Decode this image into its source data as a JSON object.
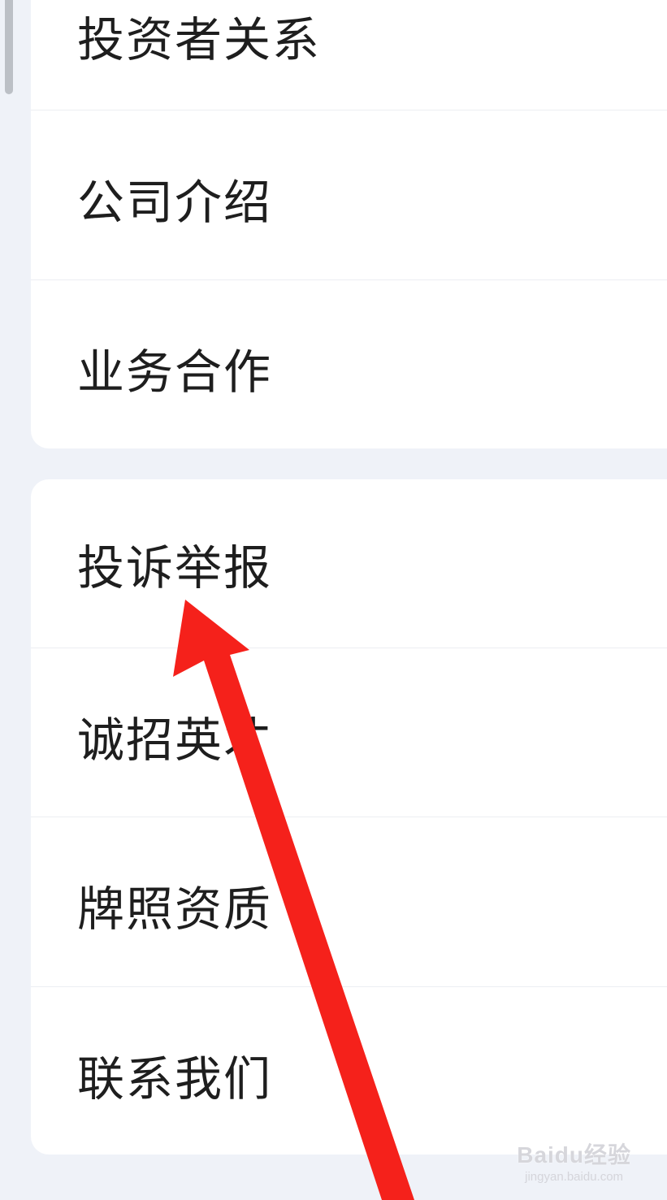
{
  "menu": {
    "group1": [
      {
        "label": "投资者关系"
      },
      {
        "label": "公司介绍"
      },
      {
        "label": "业务合作"
      }
    ],
    "group2": [
      {
        "label": "投诉举报"
      },
      {
        "label": "诚招英才"
      },
      {
        "label": "牌照资质"
      },
      {
        "label": "联系我们"
      }
    ]
  },
  "annotation": {
    "arrow_color": "#f5211b",
    "points_to": "投诉举报"
  },
  "watermark": {
    "logo": "Baidu经验",
    "url": "jingyan.baidu.com"
  }
}
